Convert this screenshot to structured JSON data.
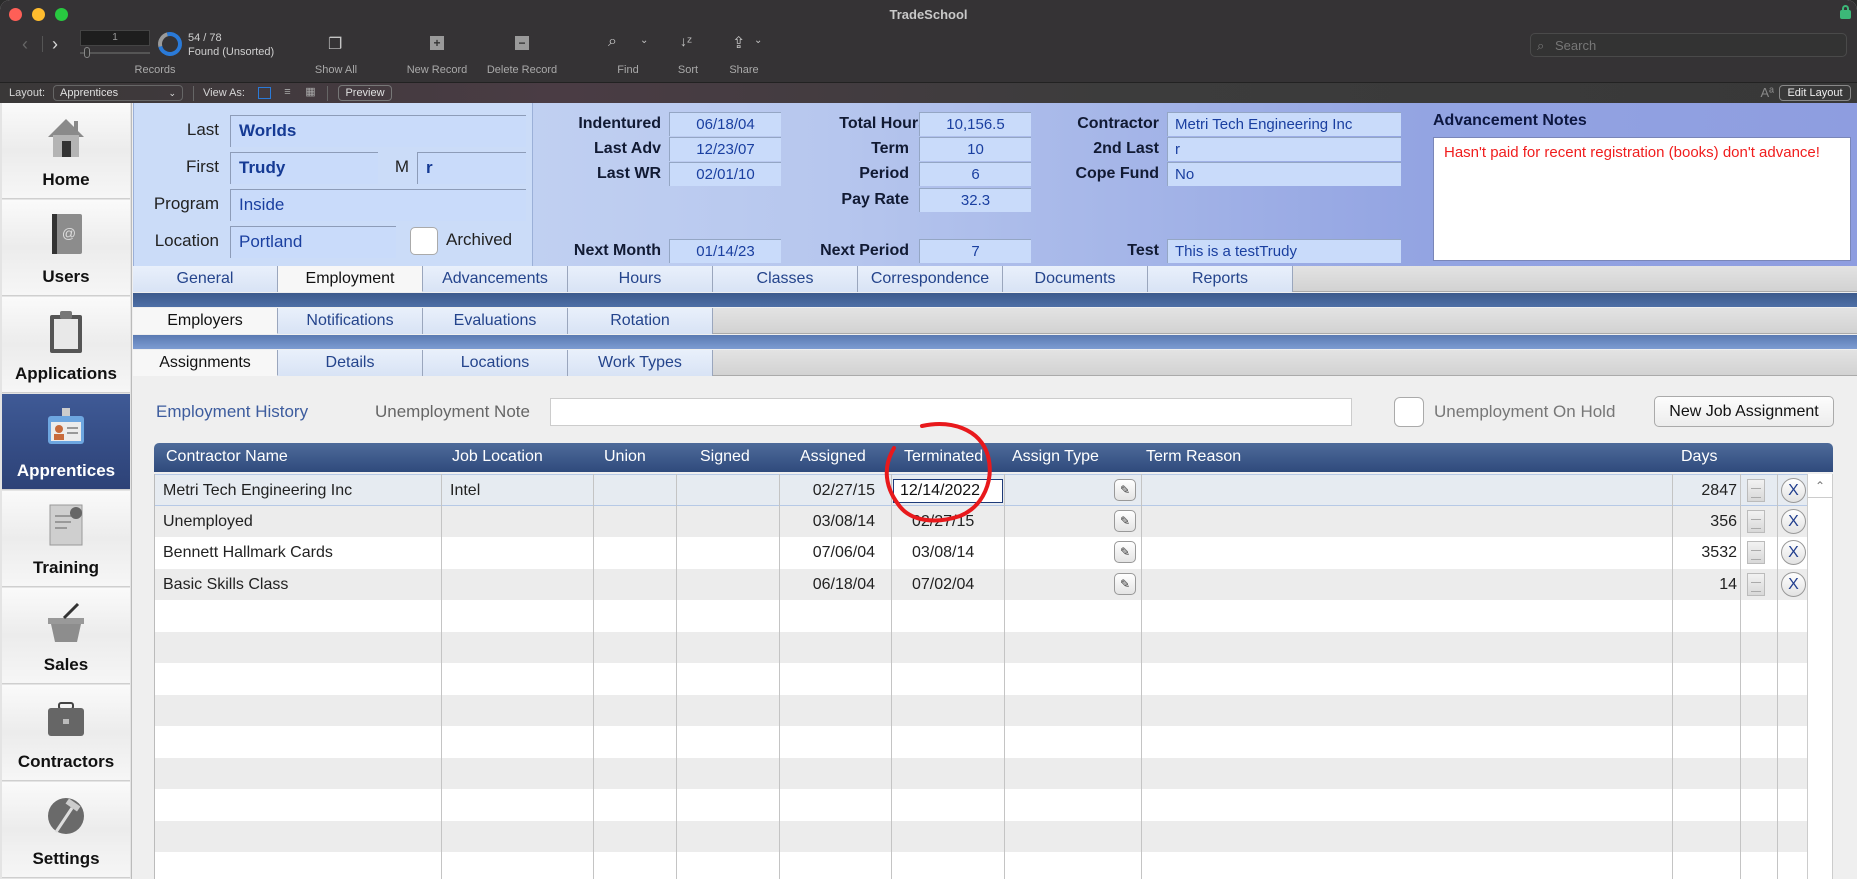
{
  "window": {
    "title": "TradeSchool"
  },
  "toolbar": {
    "record_number": "1",
    "found_count": "54 / 78",
    "found_status": "Found (Unsorted)",
    "found_fraction": 0.692,
    "records_label": "Records",
    "show_all_label": "Show All",
    "new_record_label": "New Record",
    "delete_record_label": "Delete Record",
    "find_label": "Find",
    "sort_label": "Sort",
    "share_label": "Share",
    "search_placeholder": "Search"
  },
  "layoutbar": {
    "layout_label": "Layout:",
    "layout_value": "Apprentices",
    "view_as_label": "View As:",
    "preview_label": "Preview",
    "edit_layout_label": "Edit Layout"
  },
  "sidebar": {
    "items": [
      {
        "label": "Home",
        "icon": "house-icon"
      },
      {
        "label": "Users",
        "icon": "address-book-icon"
      },
      {
        "label": "Applications",
        "icon": "clipboard-icon"
      },
      {
        "label": "Apprentices",
        "icon": "id-badge-icon",
        "active": true
      },
      {
        "label": "Training",
        "icon": "certificate-icon"
      },
      {
        "label": "Sales",
        "icon": "basket-icon"
      },
      {
        "label": "Contractors",
        "icon": "briefcase-icon"
      },
      {
        "label": "Settings",
        "icon": "hammer-icon"
      }
    ]
  },
  "apprentice": {
    "last_label": "Last",
    "last": "Worlds",
    "first_label": "First",
    "first": "Trudy",
    "middle_label": "M",
    "middle": "r",
    "program_label": "Program",
    "program": "Inside",
    "location_label": "Location",
    "location": "Portland",
    "archived_label": "Archived"
  },
  "status": {
    "indentured_label": "Indentured",
    "indentured": "06/18/04",
    "last_adv_label": "Last Adv",
    "last_adv": "12/23/07",
    "last_wr_label": "Last WR",
    "last_wr": "02/01/10",
    "next_month_label": "Next Month",
    "next_month": "01/14/23",
    "total_hours_label": "Total Hours",
    "total_hours": "10,156.5",
    "term_label": "Term",
    "term": "10",
    "period_label": "Period",
    "period": "6",
    "pay_rate_label": "Pay Rate",
    "pay_rate": "32.3",
    "next_period_label": "Next Period",
    "next_period": "7",
    "contractor_label": "Contractor",
    "contractor": "Metri Tech Engineering Inc",
    "second_last_label": "2nd Last",
    "second_last": "r",
    "cope_fund_label": "Cope Fund",
    "cope_fund": "No",
    "test_label": "Test",
    "test": "This is a testTrudy"
  },
  "notes": {
    "title": "Advancement Notes",
    "text": "Hasn't paid for recent registration (books) don't advance!"
  },
  "tabs": {
    "main": [
      "General",
      "Employment",
      "Advancements",
      "Hours",
      "Classes",
      "Correspondence",
      "Documents",
      "Reports"
    ],
    "main_active": "Employment",
    "sub": [
      "Employers",
      "Notifications",
      "Evaluations",
      "Rotation"
    ],
    "sub_active": "Employers",
    "sub2": [
      "Assignments",
      "Details",
      "Locations",
      "Work Types"
    ],
    "sub2_active": "Assignments"
  },
  "employment": {
    "history_label": "Employment History",
    "unemployment_note_label": "Unemployment Note",
    "unemployment_note": "",
    "on_hold_label": "Unemployment On Hold",
    "new_job_label": "New Job Assignment",
    "columns": [
      "Contractor Name",
      "Job Location",
      "Union",
      "Signed",
      "Assigned",
      "Terminated",
      "Assign Type",
      "Term Reason",
      "Days"
    ],
    "rows": [
      {
        "contractor": "Metri Tech Engineering Inc",
        "job_location": "Intel",
        "union": "",
        "signed": "",
        "assigned": "02/27/15",
        "terminated": "12/14/2022",
        "assign_type": "",
        "term_reason": "",
        "days": "2847"
      },
      {
        "contractor": "Unemployed",
        "job_location": "",
        "union": "",
        "signed": "",
        "assigned": "03/08/14",
        "terminated": "02/27/15",
        "assign_type": "",
        "term_reason": "",
        "days": "356"
      },
      {
        "contractor": "Bennett Hallmark Cards",
        "job_location": "",
        "union": "",
        "signed": "",
        "assigned": "07/06/04",
        "terminated": "03/08/14",
        "assign_type": "",
        "term_reason": "",
        "days": "3532"
      },
      {
        "contractor": "Basic Skills Class",
        "job_location": "",
        "union": "",
        "signed": "",
        "assigned": "06/18/04",
        "terminated": "07/02/04",
        "assign_type": "",
        "term_reason": "",
        "days": "14"
      }
    ],
    "delete_glyph": "X",
    "annotation_color": "#e8191c"
  }
}
